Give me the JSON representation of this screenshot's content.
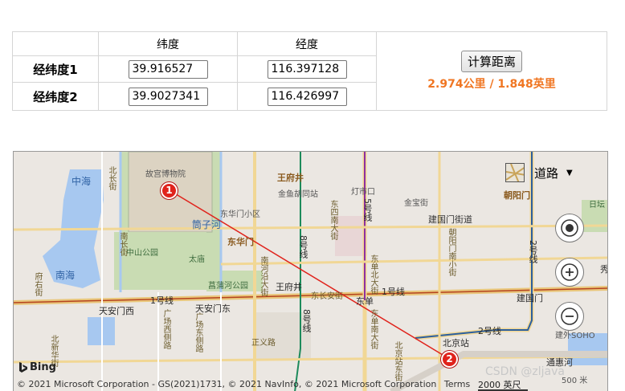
{
  "calculator": {
    "header_lat": "纬度",
    "header_lng": "经度",
    "rows": [
      {
        "label": "经纬度1",
        "lat": "39.916527",
        "lng": "116.397128"
      },
      {
        "label": "经纬度2",
        "lat": "39.9027341",
        "lng": "116.426997"
      }
    ],
    "button_label": "计算距离",
    "result": "2.974公里 / 1.848英里",
    "result_color": "#f07622"
  },
  "map": {
    "map_type": "道路",
    "markers": [
      {
        "label": "1"
      },
      {
        "label": "2"
      }
    ],
    "route_color": "#e0231c",
    "labels": {
      "forbidden_city": "故宫博物院",
      "zhonghai": "中海",
      "nanhai": "南海",
      "zhongshan_park": "中山公园",
      "taimiao": "太庙",
      "tongzi_river": "筒子河",
      "donghuamen": "东华门小区",
      "donghuamen2": "东华门",
      "wangfujing": "王府井",
      "wangfujing2": "王府井",
      "jinyu": "金鱼胡同站",
      "dengshikou": "灯市口",
      "jinbao": "金宝街",
      "jianguomen_st": "建国门街道",
      "chaoyangmen": "朝阳门",
      "ritan": "日坛",
      "changpu_park": "菖蒲河公园",
      "tiananmen_w": "天安门西",
      "tiananmen_e": "天安门东",
      "dongdan": "东单",
      "jianguomen": "建国门",
      "line1_a": "1号线",
      "line1_b": "1号线",
      "line2": "2号线",
      "line2_v": "2号线",
      "line5": "5号线",
      "line8_a": "8号线",
      "line8_b": "8号线",
      "changan": "东长安街",
      "zhengyi": "正义路",
      "beijing_station": "北京站",
      "tonghui": "通惠河",
      "jianwaishi": "建外SOHO",
      "beijing_station_e": "北京站东街",
      "nanchang": "南长街",
      "beichang": "北长街",
      "fuyou": "府右街",
      "nanheyan": "南河沿大街",
      "dongdan_n": "东单北大街",
      "chaoyangmen_s": "朝阳门南小街",
      "dongdan_s": "东单南大街",
      "dongsi": "东四南大街",
      "guangchang": "广场西侧路",
      "guangchang_e": "广场东侧路",
      "beixin": "北新华街",
      "xiu": "秀"
    },
    "bing_label": "Bing",
    "copyright": "© 2021 Microsoft Corporation - GS(2021)1731, © 2021 NavInfo, © 2021 Microsoft Corporation",
    "terms": "Terms",
    "scale_label": "2000 英尺",
    "scale_label_small": "500 米"
  },
  "watermark": "CSDN @zljava",
  "icons": {
    "locate": "locate-icon",
    "zoom_in": "zoom-in-icon",
    "zoom_out": "zoom-out-icon",
    "map_type": "map-type-icon",
    "dropdown": "caret-down-icon"
  }
}
